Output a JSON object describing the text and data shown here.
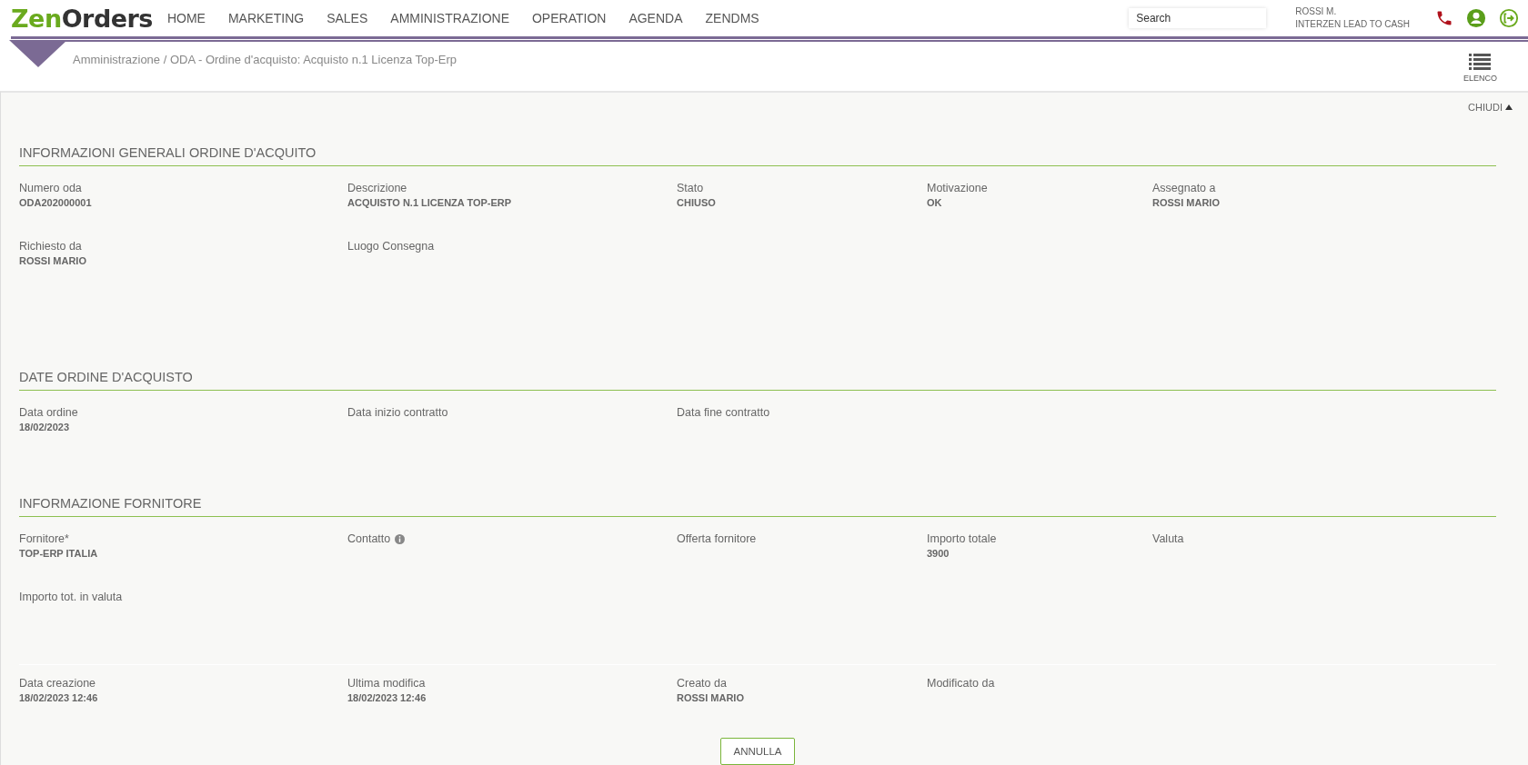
{
  "logo": {
    "first": "Zen",
    "second": "Orders"
  },
  "nav": [
    {
      "label": "HOME"
    },
    {
      "label": "MARKETING"
    },
    {
      "label": "SALES"
    },
    {
      "label": "AMMINISTRAZIONE"
    },
    {
      "label": "OPERATION"
    },
    {
      "label": "AGENDA"
    },
    {
      "label": "ZENDMS"
    }
  ],
  "search": {
    "placeholder": "Search"
  },
  "user": {
    "name": "ROSSI M.",
    "company": "INTERZEN LEAD TO CASH"
  },
  "breadcrumb": "Amministrazione / ODA - Ordine d'acquisto: Acquisto n.1 Licenza Top-Erp",
  "list_button": "ELENCO",
  "collapse_button": "CHIUDI",
  "sections": [
    {
      "title": "INFORMAZIONI GENERALI ORDINE D'ACQUITO",
      "fields": [
        {
          "label": "Numero oda",
          "value": "ODA202000001",
          "info": false
        },
        {
          "label": "Descrizione",
          "value": "ACQUISTO N.1 LICENZA TOP-ERP",
          "info": false
        },
        {
          "label": "Stato",
          "value": "CHIUSO",
          "info": false
        },
        {
          "label": "Motivazione",
          "value": "OK",
          "info": false
        },
        {
          "label": "Assegnato a",
          "value": "ROSSI MARIO",
          "info": false
        },
        {
          "label": "Richiesto da",
          "value": "ROSSI MARIO",
          "info": false
        },
        {
          "label": "Luogo Consegna",
          "info": false
        }
      ]
    },
    {
      "title": "DATE ORDINE D'ACQUISTO",
      "fields": [
        {
          "label": "Data ordine",
          "value": "18/02/2023",
          "info": false
        },
        {
          "label": "Data inizio contratto",
          "info": false
        },
        {
          "label": "Data fine contratto",
          "info": false
        }
      ]
    },
    {
      "title": "INFORMAZIONE FORNITORE",
      "fields": [
        {
          "label": "Fornitore*",
          "value": "TOP-ERP ITALIA",
          "info": false
        },
        {
          "label": "Contatto",
          "info": true
        },
        {
          "label": "Offerta fornitore",
          "info": false
        },
        {
          "label": "Importo totale",
          "value": "3900",
          "info": false
        },
        {
          "label": "Valuta",
          "info": false
        },
        {
          "label": "Importo tot. in valuta",
          "info": false
        }
      ]
    }
  ],
  "audit": [
    {
      "label": "Data creazione",
      "value": "18/02/2023 12:46"
    },
    {
      "label": "Ultima modifica",
      "value": "18/02/2023 12:46"
    },
    {
      "label": "Creato da",
      "value": "ROSSI MARIO"
    },
    {
      "label": "Modificato da"
    }
  ],
  "cancel_button": "ANNULLA"
}
